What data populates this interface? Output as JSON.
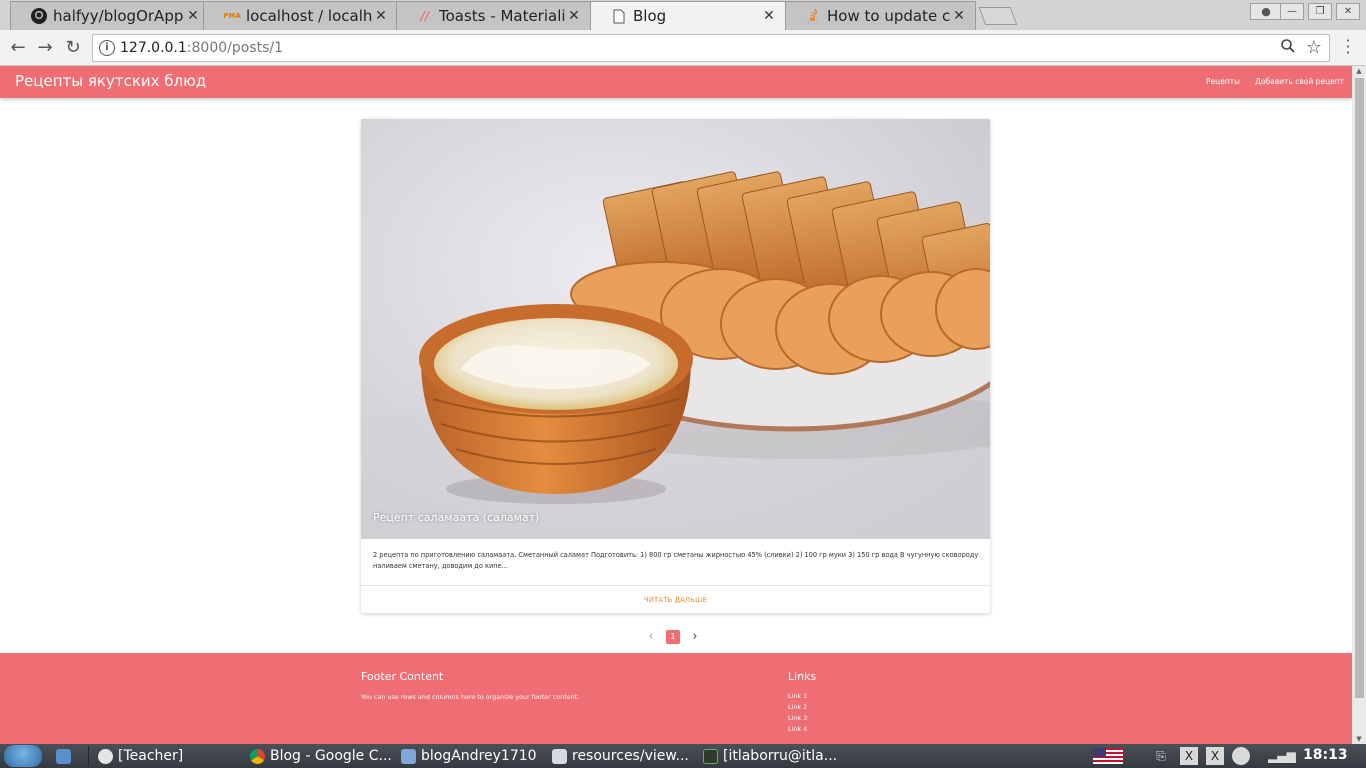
{
  "browser": {
    "tabs": [
      {
        "title": "halfyy/blogOrApp",
        "icon": "github-icon",
        "active": false
      },
      {
        "title": "localhost / localhos",
        "icon": "phpmyadmin-icon",
        "active": false
      },
      {
        "title": "Toasts - Materialize",
        "icon": "materialize-icon",
        "active": false
      },
      {
        "title": "Blog",
        "icon": "page-icon",
        "active": true
      },
      {
        "title": "How to update colu",
        "icon": "stackoverflow-icon",
        "active": false
      }
    ],
    "url_host": "127.0.0.1",
    "url_rest": ":8000/posts/1"
  },
  "site": {
    "brand": "Рецепты якутских блюд",
    "nav": [
      "Рецепты",
      "Добавить свой рецепт"
    ],
    "accent": "#ee6e73",
    "action_color": "#ef8a32"
  },
  "post": {
    "image_alt": "salamat",
    "title": "Рецепт саламаата (саламат)",
    "excerpt": "2 рецепта по приготовлению саламаата. Сметанный саламат Подготовить: 1) 800 гр сметаны жирностью 45% (сливки) 2) 100 гр муки 3) 150 гр вода В чугунную сковороду наливаем сметану, доводим до кипе...",
    "read_more": "ЧИТАТЬ ДАЛЬШЕ"
  },
  "pagination": {
    "current": "1",
    "prev_icon": "‹",
    "next_icon": "›"
  },
  "footer": {
    "heading": "Footer Content",
    "text": "You can use rows and columns here to organize your footer content.",
    "links_heading": "Links",
    "links": [
      "Link 1",
      "Link 2",
      "Link 3",
      "Link 4"
    ]
  },
  "taskbar": {
    "items": [
      {
        "label": "[Teacher]"
      },
      {
        "label": "Blog - Google C..."
      },
      {
        "label": "blogAndrey1710"
      },
      {
        "label": "resources/view..."
      },
      {
        "label": "[itlaborru@itla..."
      }
    ],
    "clock": "18:13"
  }
}
